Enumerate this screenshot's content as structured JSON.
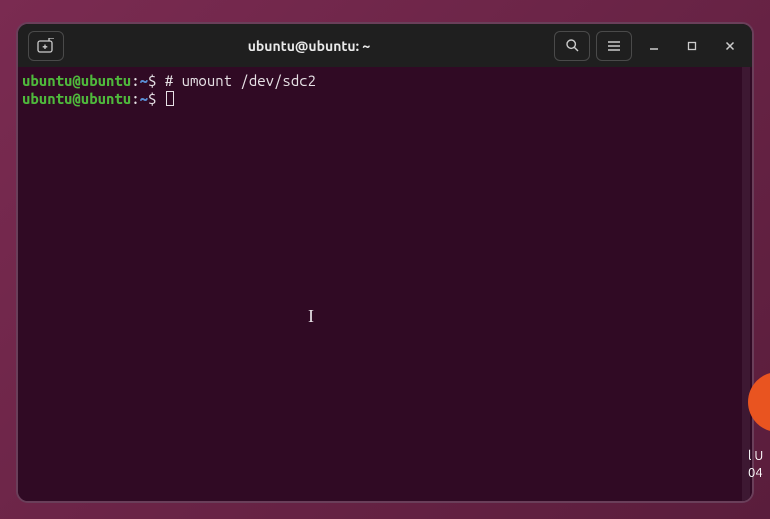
{
  "window": {
    "title": "ubuntu@ubuntu: ~"
  },
  "terminal": {
    "lines": [
      {
        "user": "ubuntu@ubuntu",
        "colon": ":",
        "path": "~",
        "dollar": "$ ",
        "cmd": "# umount /dev/sdc2"
      },
      {
        "user": "ubuntu@ubuntu",
        "colon": ":",
        "path": "~",
        "dollar": "$ ",
        "cmd": ""
      }
    ]
  },
  "desktop": {
    "label_line1": "l U",
    "label_line2": "04"
  }
}
